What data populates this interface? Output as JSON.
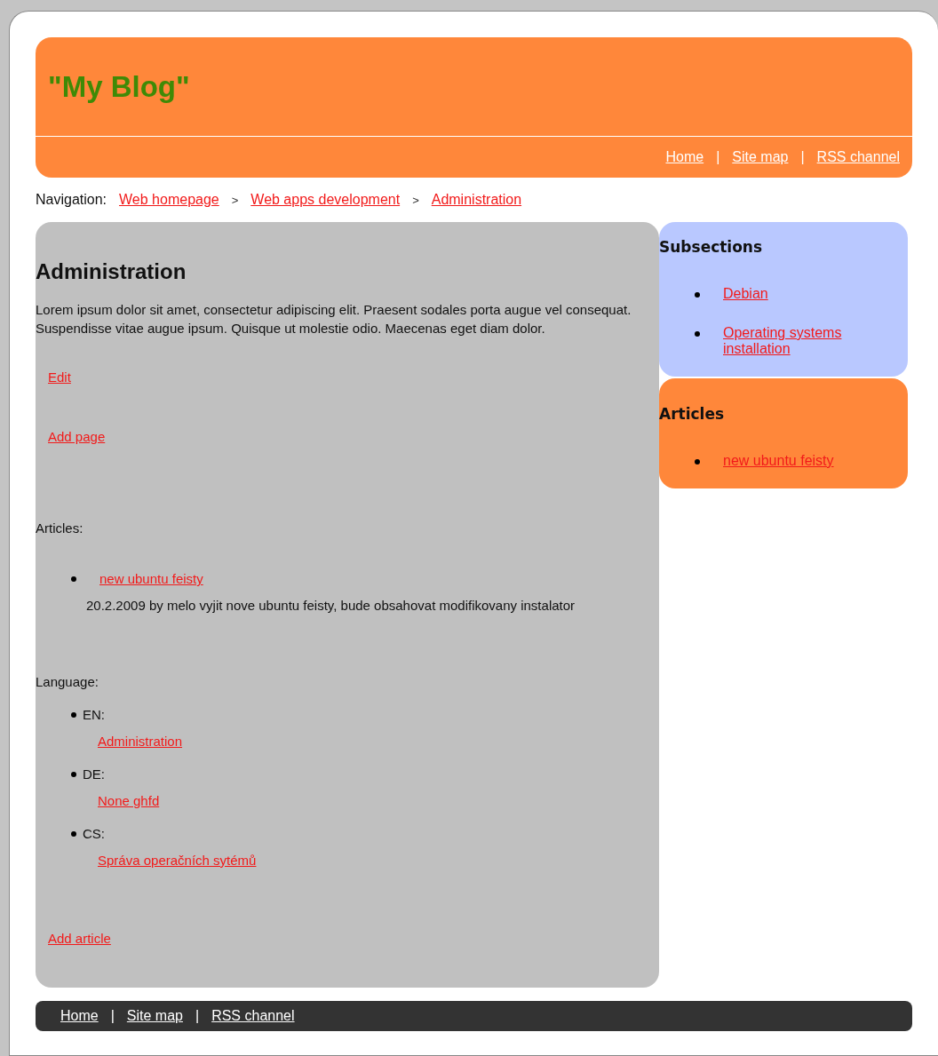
{
  "header": {
    "title": "\"My Blog\"",
    "nav": [
      {
        "kind": "link",
        "text": "Home"
      },
      {
        "kind": "separator",
        "text": "|"
      },
      {
        "kind": "link",
        "text": "Site map"
      },
      {
        "kind": "separator",
        "text": "|"
      },
      {
        "kind": "link",
        "text": "RSS channel"
      }
    ]
  },
  "breadcrumb": {
    "label": "Navigation:",
    "items": [
      {
        "kind": "link",
        "text": "Web homepage"
      },
      {
        "kind": "separator",
        "text": ">"
      },
      {
        "kind": "link",
        "text": "Web apps development"
      },
      {
        "kind": "separator",
        "text": ">"
      },
      {
        "kind": "link",
        "text": "Administration"
      }
    ]
  },
  "main": {
    "heading": "Administration",
    "body": "Lorem ipsum dolor sit amet, consectetur adipiscing elit. Praesent sodales porta augue vel consequat. Suspendisse vitae augue ipsum. Quisque ut molestie odio. Maecenas eget diam dolor.",
    "actions": [
      "Edit",
      "Add page"
    ],
    "articles_label": "Articles:",
    "articles": [
      {
        "title": "new ubuntu feisty",
        "summary": "20.2.2009 by melo vyjit nove ubuntu feisty, bude obsahovat modifikovany instalator"
      }
    ],
    "language_label": "Language:",
    "languages": [
      {
        "code": "EN:",
        "link": "Administration"
      },
      {
        "code": "DE:",
        "link": "None ghfd"
      },
      {
        "code": "CS:",
        "link": "Správa operačních sytémů"
      }
    ],
    "add_article": "Add article"
  },
  "sidebar": [
    {
      "kind": "subsections",
      "heading": "Subsections",
      "links": [
        "Debian",
        "Operating systems installation"
      ]
    },
    {
      "kind": "articles",
      "heading": "Articles",
      "links": [
        "new ubuntu feisty"
      ]
    }
  ],
  "footer": {
    "nav": [
      {
        "kind": "link",
        "text": "Home"
      },
      {
        "kind": "separator",
        "text": "|"
      },
      {
        "kind": "link",
        "text": "Site map"
      },
      {
        "kind": "separator",
        "text": "|"
      },
      {
        "kind": "link",
        "text": "RSS channel"
      }
    ]
  }
}
